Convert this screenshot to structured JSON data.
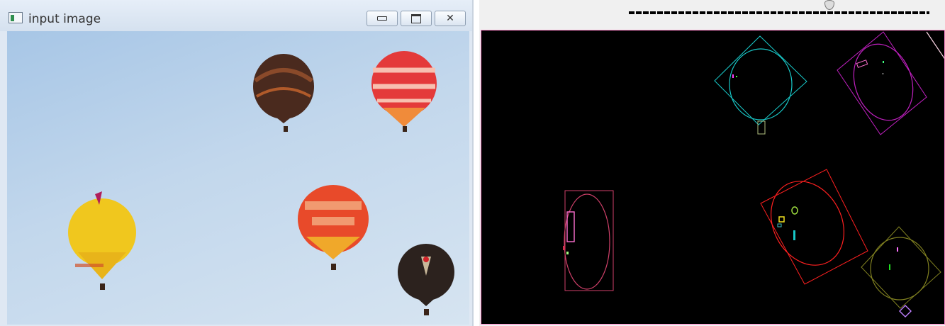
{
  "window": {
    "title": "input image"
  },
  "controls": {
    "minimize": "minimize",
    "maximize": "maximize",
    "close": "close"
  },
  "colors": {
    "sky_top": "#a7c6e6",
    "sky_bottom": "#d6e4f1",
    "canvas_bg": "#000000",
    "cyan": "#18c8c8",
    "magenta": "#c020c0",
    "red": "#ff2020",
    "olive": "#808020",
    "pink": "#ff70d0",
    "lime": "#a0e040"
  },
  "icons": {
    "app": "app-window-icon",
    "minimize": "minimize-icon",
    "maximize": "maximize-icon",
    "close": "close-icon"
  }
}
